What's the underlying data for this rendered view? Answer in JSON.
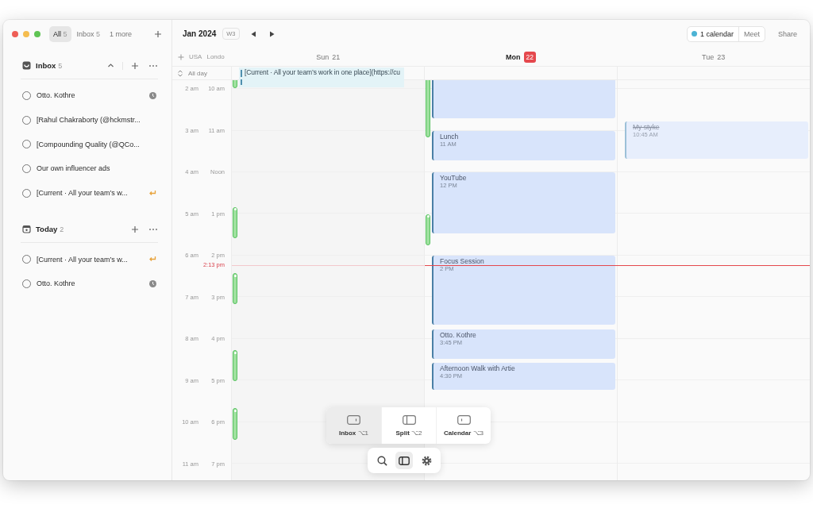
{
  "tabs": [
    {
      "label": "All",
      "count": "5",
      "selected": true
    },
    {
      "label": "Inbox",
      "count": "5",
      "selected": false
    },
    {
      "label": "1 more",
      "selected": false
    }
  ],
  "sidebar": {
    "sections": [
      {
        "kind": "inbox",
        "title": "Inbox",
        "count": "5",
        "collapsible": true,
        "items": [
          {
            "title": "Otto. Kothre",
            "checked": false,
            "kind": "scheduled"
          },
          {
            "title": "[Rahul Chakraborty (@hckmstr...",
            "checked": false,
            "kind": "plain"
          },
          {
            "title": "[Compounding Quality (@QCo...",
            "checked": false,
            "kind": "plain"
          },
          {
            "title": "Our own influencer ads",
            "checked": false,
            "kind": "plain"
          },
          {
            "title": "[Current · All your team’s w...",
            "checked": false,
            "kind": "linked"
          }
        ]
      },
      {
        "kind": "today",
        "title": "Today",
        "count": "2",
        "collapsible": false,
        "items": [
          {
            "title": "[Current · All your team’s w...",
            "checked": false,
            "kind": "linked"
          },
          {
            "title": "Otto. Kothre",
            "checked": false,
            "kind": "scheduled"
          }
        ]
      }
    ]
  },
  "calendar": {
    "month": "Jan 2024",
    "week": "W3",
    "timezones": [
      "USA",
      "Londo"
    ],
    "all_day_label": "All day",
    "now": "2:13 pm",
    "hours": [
      {
        "usa": "2 am",
        "london": "10 am"
      },
      {
        "usa": "3 am",
        "london": "11 am"
      },
      {
        "usa": "4 am",
        "london": "Noon"
      },
      {
        "usa": "5 am",
        "london": "1 pm"
      },
      {
        "usa": "6 am",
        "london": "2 pm"
      },
      {
        "usa": "7 am",
        "london": "3 pm"
      },
      {
        "usa": "8 am",
        "london": "4 pm"
      },
      {
        "usa": "9 am",
        "london": "5 pm"
      },
      {
        "usa": "10 am",
        "london": "6 pm"
      },
      {
        "usa": "11 am",
        "london": "7 pm"
      }
    ],
    "days": [
      {
        "weekday": "Sun",
        "date": "21",
        "today": false,
        "all_day": [
          "[Current · All your team’s work in one place](https://cu"
        ]
      },
      {
        "weekday": "Mon",
        "date": "22",
        "today": true,
        "events": [
          {
            "done": false
          },
          {
            "title": "Lunch",
            "time": "11 AM",
            "done": false
          },
          {
            "title": "YouTube",
            "time": "12 PM",
            "done": false
          },
          {
            "title": "Focus Session",
            "time": "2 PM",
            "done": false
          },
          {
            "title": "Otto. Kothre",
            "time": "3:45 PM",
            "done": false
          },
          {
            "title": "Afternoon Walk with Artie",
            "time": "4:30 PM",
            "done": false
          }
        ]
      },
      {
        "weekday": "Tue",
        "date": "23",
        "today": false,
        "events": [
          {
            "title": "My styke",
            "time": "10:45 AM",
            "done": true
          }
        ]
      }
    ]
  },
  "header_actions": {
    "calendars": "1 calendar",
    "meet": "Meet",
    "share": "Share"
  },
  "view_switcher": [
    {
      "label": "Inbox",
      "shortcut": "⌥1",
      "kind": "inbox",
      "selected": true
    },
    {
      "label": "Split",
      "shortcut": "⌥2",
      "kind": "split",
      "selected": false
    },
    {
      "label": "Calendar",
      "shortcut": "⌥3",
      "kind": "calendar",
      "selected": false
    }
  ],
  "toolbar": [
    {
      "kind": "search",
      "selected": false
    },
    {
      "kind": "split",
      "selected": true
    },
    {
      "kind": "settings",
      "selected": false
    }
  ]
}
